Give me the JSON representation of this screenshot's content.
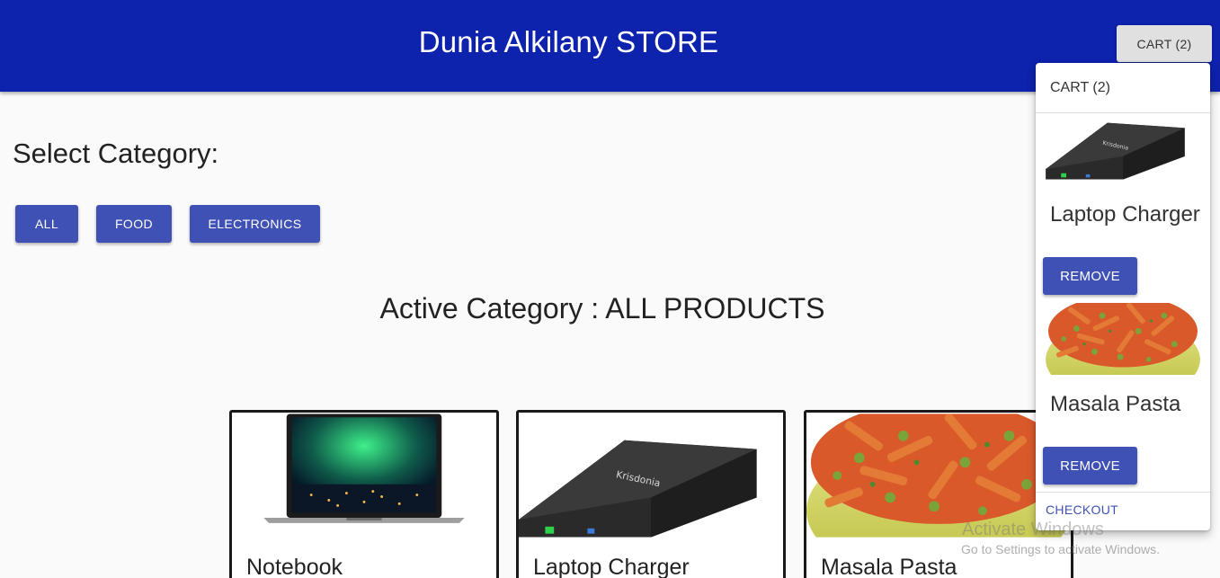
{
  "header": {
    "store_title": "Dunia Alkilany STORE",
    "cart_button_label": "CART (2)",
    "background_color": "#0d22ad"
  },
  "categories": {
    "heading": "Select Category:",
    "buttons": [
      {
        "label": "ALL"
      },
      {
        "label": "FOOD"
      },
      {
        "label": "ELECTRONICS"
      }
    ],
    "active_heading": "Active Category : ALL PRODUCTS",
    "accent_color": "#3f51b5"
  },
  "products": [
    {
      "name": "Notebook",
      "image": "laptop-image"
    },
    {
      "name": "Laptop Charger",
      "image": "charger-image"
    },
    {
      "name": "Masala Pasta",
      "image": "pasta-image"
    }
  ],
  "cart": {
    "title": "CART (2)",
    "items": [
      {
        "name": "Laptop Charger",
        "image": "charger-image",
        "remove_label": "REMOVE"
      },
      {
        "name": "Masala Pasta",
        "image": "pasta-image",
        "remove_label": "REMOVE"
      }
    ],
    "checkout_label": "CHECKOUT"
  },
  "watermark": {
    "title": "Activate Windows",
    "subtitle": "Go to Settings to activate Windows."
  }
}
